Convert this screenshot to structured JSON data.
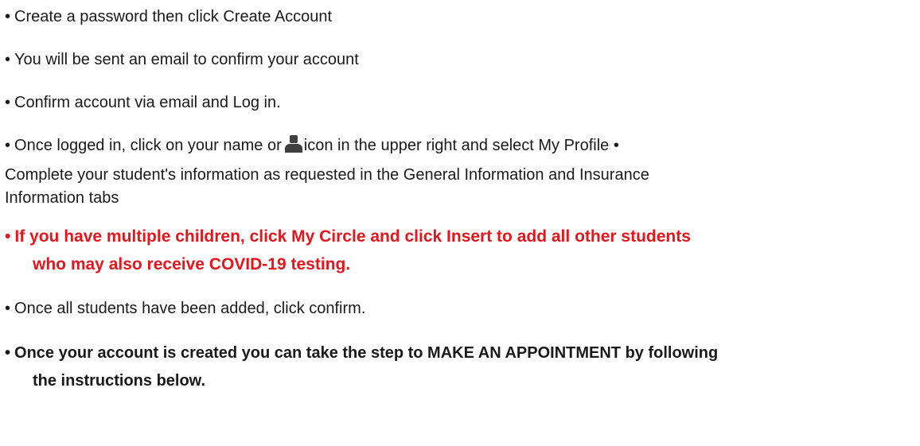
{
  "bullet": "•",
  "items": {
    "create_password": "Create a password then click Create Account",
    "email_sent": "You will be sent an email to confirm your account",
    "confirm_login": "Confirm account via email and Log in.",
    "profile_part1": "Once logged in, click on your name or",
    "profile_part2": "icon in the upper right and select My Profile",
    "profile_line2": "Complete your student's information as requested in the General Information and Insurance",
    "profile_line3": "Information tabs",
    "multiple_line1": "If you have multiple children, click My Circle and click Insert to add all other students",
    "multiple_line2": "who may also receive COVID-19 testing.",
    "all_added": "Once all students have been added, click confirm.",
    "appointment_line1": "Once your account is created you can take the step to MAKE AN APPOINTMENT by following",
    "appointment_line2": "the instructions below."
  },
  "icons": {
    "user": "user-icon"
  },
  "colors": {
    "text": "#1a1a1a",
    "highlight_red": "#e8141b",
    "icon": "#3f3f3f"
  }
}
